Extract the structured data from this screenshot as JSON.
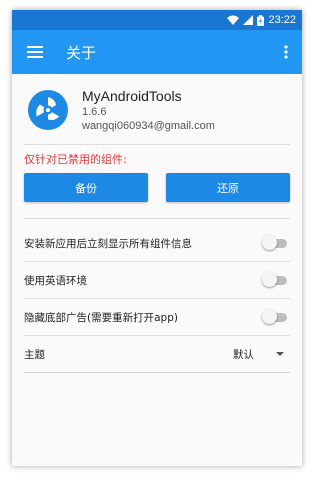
{
  "status_bar": {
    "time": "23:22",
    "icons": [
      "wifi-icon",
      "signal-icon",
      "battery-icon"
    ]
  },
  "app_bar": {
    "title": "关于",
    "menu_icon": "hamburger-menu-icon",
    "overflow_icon": "more-vert-icon"
  },
  "about": {
    "app_name": "MyAndroidTools",
    "version": "1.6.6",
    "email": "wangqi060934@gmail.com",
    "logo_icon": "app-logo-icon"
  },
  "disabled_components": {
    "warning": "仅针对已禁用的组件:",
    "backup_label": "备份",
    "restore_label": "还原"
  },
  "settings": [
    {
      "label": "安装新应用后立刻显示所有组件信息",
      "enabled": false
    },
    {
      "label": "使用英语环境",
      "enabled": false
    },
    {
      "label": "隐藏底部广告(需要重新打开app)",
      "enabled": false
    }
  ],
  "theme": {
    "label": "主题",
    "value": "默认"
  },
  "colors": {
    "status_bar": "#1976d2",
    "app_bar": "#2196f3",
    "button": "#1e88e5",
    "warning_text": "#e53935"
  }
}
